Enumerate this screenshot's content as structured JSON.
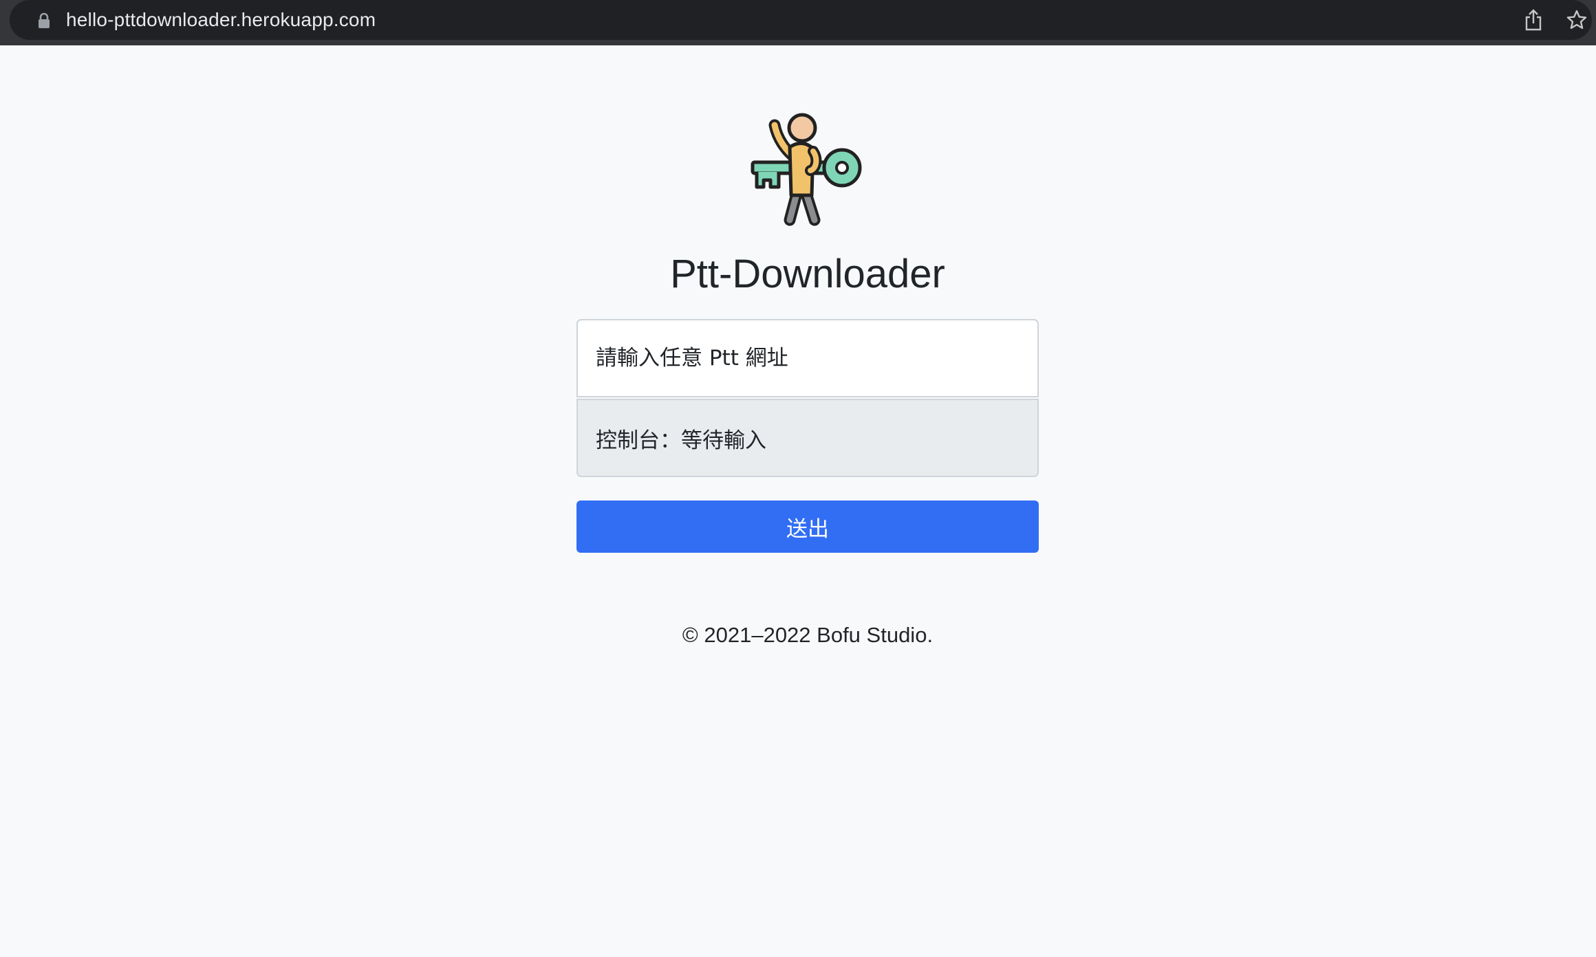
{
  "browser": {
    "url": "hello-pttdownloader.herokuapp.com"
  },
  "icons": {
    "lock": "lock-icon",
    "share": "share-icon",
    "bookmark": "star-icon",
    "logo": "person-with-key-logo"
  },
  "colors": {
    "primary_button": "#326ef4",
    "console_bg": "#e9ecef",
    "page_bg": "#f8f9fa"
  },
  "main": {
    "title": "Ptt-Downloader",
    "url_input": {
      "placeholder": "請輸入任意 Ptt 網址",
      "value": ""
    },
    "console_text": "控制台：等待輸入",
    "submit_label": "送出"
  },
  "footer": {
    "copyright": "© 2021–2022 Bofu Studio."
  }
}
